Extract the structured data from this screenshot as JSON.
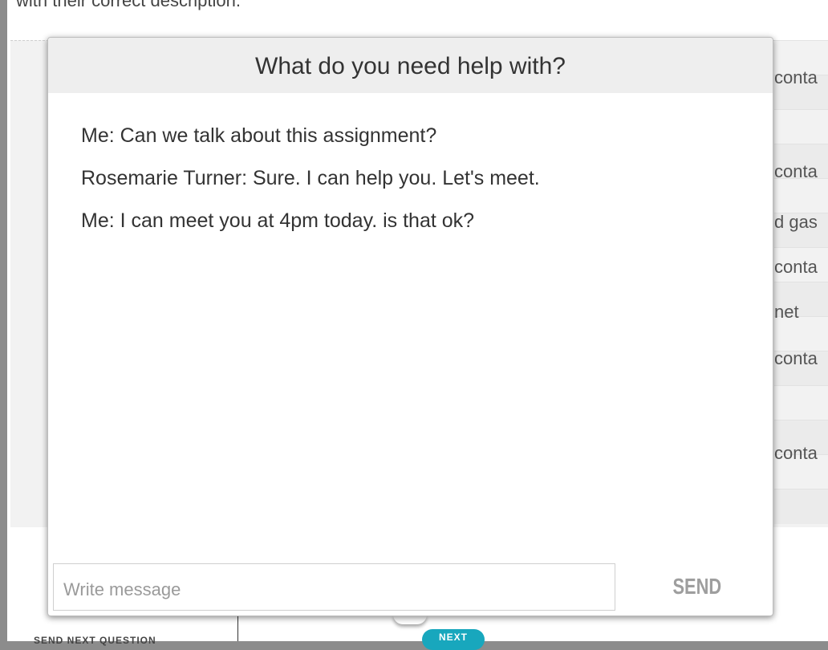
{
  "background_page": {
    "top_text": "with their correct description.",
    "right_words": [
      "conta",
      "conta",
      "d gas",
      "conta",
      "net",
      "conta",
      "conta"
    ],
    "bottom_left_text": "SEND NEXT QUESTION",
    "next_button_label": "NEXT"
  },
  "chat": {
    "title": "What do you need help with?",
    "messages": [
      {
        "text": "Me: Can we talk about this assignment?"
      },
      {
        "text": "Rosemarie Turner: Sure. I can help you. Let's meet."
      },
      {
        "text": "Me: I can meet you at 4pm today. is that ok?"
      }
    ],
    "input_placeholder": "Write message",
    "input_value": "",
    "send_label": "SEND"
  },
  "colors": {
    "accent": "#18a7bd",
    "header_bg": "#eeeeee",
    "send_text": "#9e9e9e"
  }
}
